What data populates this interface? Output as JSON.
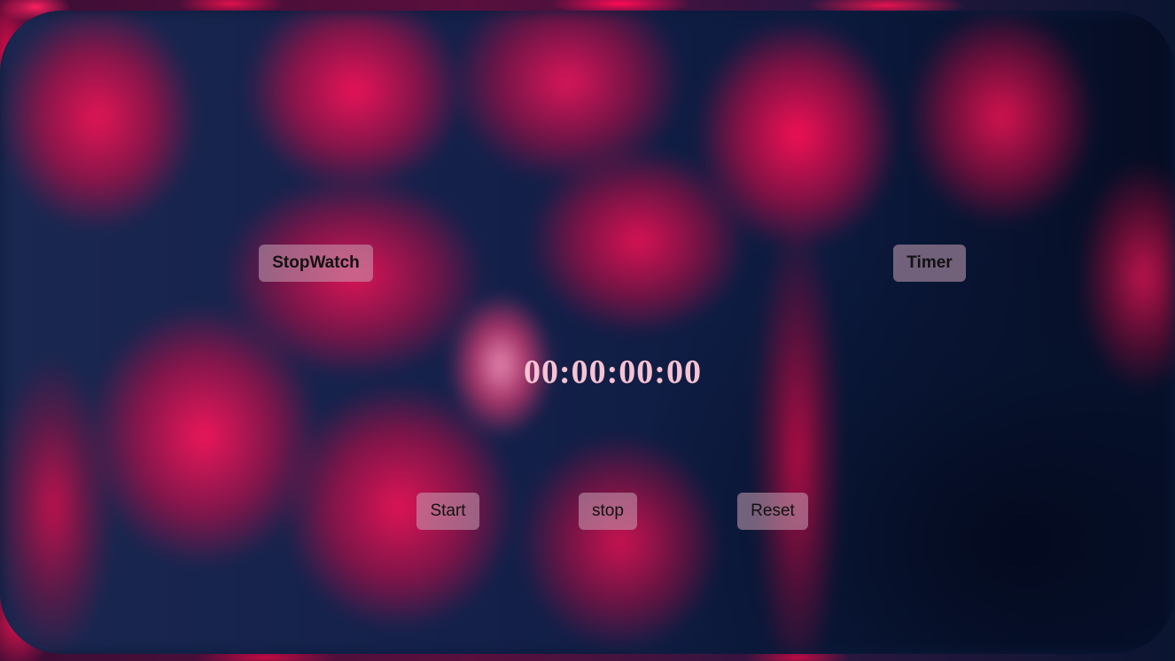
{
  "tabs": {
    "stopwatch_label": "StopWatch",
    "timer_label": "Timer"
  },
  "display": {
    "time": "00:00:00:00"
  },
  "controls": {
    "start_label": "Start",
    "stop_label": "stop",
    "reset_label": "Reset"
  },
  "colors": {
    "accent_primary": "#ff0a55",
    "background_dark": "#0b1b3a",
    "display_text": "#f7c3d3",
    "button_bg": "#c8a0b4"
  }
}
